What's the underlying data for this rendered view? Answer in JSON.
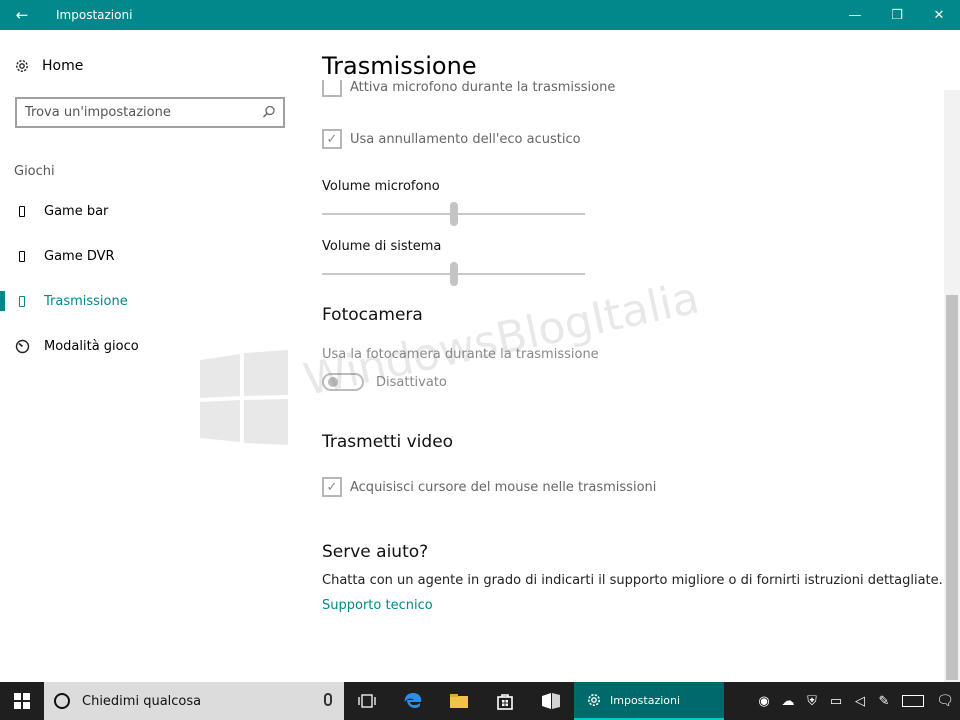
{
  "window": {
    "title": "Impostazioni",
    "back_icon": "←",
    "minimize_icon": "—",
    "maximize_icon": "❐",
    "close_icon": "✕"
  },
  "sidebar": {
    "home_label": "Home",
    "search_placeholder": "Trova un'impostazione",
    "section_label": "Giochi",
    "items": [
      {
        "label": "Game bar",
        "active": false
      },
      {
        "label": "Game DVR",
        "active": false
      },
      {
        "label": "Trasmissione",
        "active": true
      },
      {
        "label": "Modalità gioco",
        "active": false
      }
    ]
  },
  "content": {
    "title": "Trasmissione",
    "partial_checkbox_label": "Attiva microfono durante la trasmissione",
    "echo_checkbox": {
      "label": "Usa annullamento dell'eco acustico",
      "checked": true
    },
    "mic_volume": {
      "label": "Volume microfono",
      "value_pct": 50
    },
    "system_volume": {
      "label": "Volume di sistema",
      "value_pct": 50
    },
    "camera": {
      "title": "Fotocamera",
      "description": "Usa la fotocamera durante la trasmissione",
      "toggle_state": "Disattivato"
    },
    "video": {
      "title": "Trasmetti video",
      "cursor_checkbox": {
        "label": "Acquisisci cursore del mouse nelle trasmissioni",
        "checked": true
      }
    },
    "help": {
      "title": "Serve aiuto?",
      "text": "Chatta con un agente in grado di indicarti il supporto migliore o di fornirti istruzioni dettagliate.",
      "link": "Supporto tecnico"
    }
  },
  "watermark": {
    "text": "WindowsBlogItalia"
  },
  "taskbar": {
    "search_text": "Chiedimi qualcosa",
    "active_app_label": "Impostazioni"
  }
}
